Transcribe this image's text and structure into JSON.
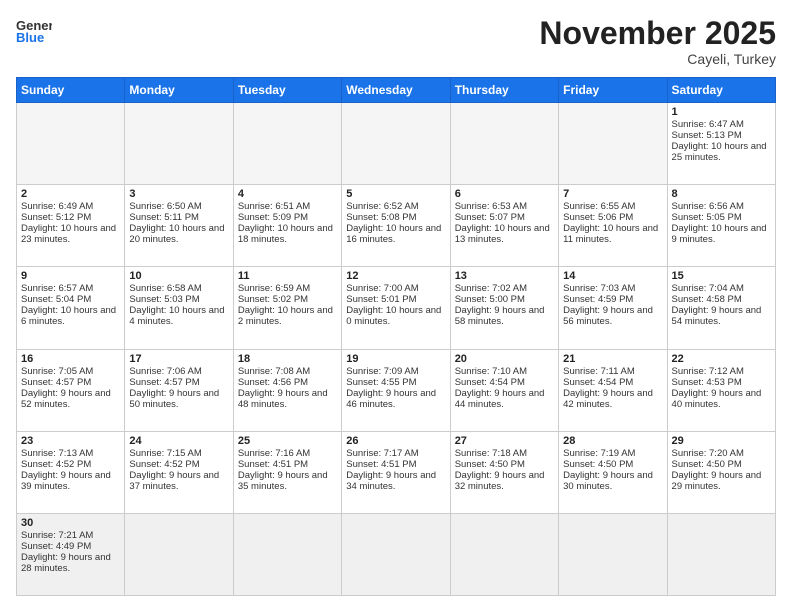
{
  "header": {
    "logo_general": "General",
    "logo_blue": "Blue",
    "month_title": "November 2025",
    "location": "Cayeli, Turkey"
  },
  "days_of_week": [
    "Sunday",
    "Monday",
    "Tuesday",
    "Wednesday",
    "Thursday",
    "Friday",
    "Saturday"
  ],
  "weeks": [
    [
      {
        "day": "",
        "sunrise": "",
        "sunset": "",
        "daylight": "",
        "empty": true
      },
      {
        "day": "",
        "sunrise": "",
        "sunset": "",
        "daylight": "",
        "empty": true
      },
      {
        "day": "",
        "sunrise": "",
        "sunset": "",
        "daylight": "",
        "empty": true
      },
      {
        "day": "",
        "sunrise": "",
        "sunset": "",
        "daylight": "",
        "empty": true
      },
      {
        "day": "",
        "sunrise": "",
        "sunset": "",
        "daylight": "",
        "empty": true
      },
      {
        "day": "",
        "sunrise": "",
        "sunset": "",
        "daylight": "",
        "empty": true
      },
      {
        "day": "1",
        "sunrise": "Sunrise: 6:47 AM",
        "sunset": "Sunset: 5:13 PM",
        "daylight": "Daylight: 10 hours and 25 minutes.",
        "empty": false
      }
    ],
    [
      {
        "day": "2",
        "sunrise": "Sunrise: 6:49 AM",
        "sunset": "Sunset: 5:12 PM",
        "daylight": "Daylight: 10 hours and 23 minutes.",
        "empty": false
      },
      {
        "day": "3",
        "sunrise": "Sunrise: 6:50 AM",
        "sunset": "Sunset: 5:11 PM",
        "daylight": "Daylight: 10 hours and 20 minutes.",
        "empty": false
      },
      {
        "day": "4",
        "sunrise": "Sunrise: 6:51 AM",
        "sunset": "Sunset: 5:09 PM",
        "daylight": "Daylight: 10 hours and 18 minutes.",
        "empty": false
      },
      {
        "day": "5",
        "sunrise": "Sunrise: 6:52 AM",
        "sunset": "Sunset: 5:08 PM",
        "daylight": "Daylight: 10 hours and 16 minutes.",
        "empty": false
      },
      {
        "day": "6",
        "sunrise": "Sunrise: 6:53 AM",
        "sunset": "Sunset: 5:07 PM",
        "daylight": "Daylight: 10 hours and 13 minutes.",
        "empty": false
      },
      {
        "day": "7",
        "sunrise": "Sunrise: 6:55 AM",
        "sunset": "Sunset: 5:06 PM",
        "daylight": "Daylight: 10 hours and 11 minutes.",
        "empty": false
      },
      {
        "day": "8",
        "sunrise": "Sunrise: 6:56 AM",
        "sunset": "Sunset: 5:05 PM",
        "daylight": "Daylight: 10 hours and 9 minutes.",
        "empty": false
      }
    ],
    [
      {
        "day": "9",
        "sunrise": "Sunrise: 6:57 AM",
        "sunset": "Sunset: 5:04 PM",
        "daylight": "Daylight: 10 hours and 6 minutes.",
        "empty": false
      },
      {
        "day": "10",
        "sunrise": "Sunrise: 6:58 AM",
        "sunset": "Sunset: 5:03 PM",
        "daylight": "Daylight: 10 hours and 4 minutes.",
        "empty": false
      },
      {
        "day": "11",
        "sunrise": "Sunrise: 6:59 AM",
        "sunset": "Sunset: 5:02 PM",
        "daylight": "Daylight: 10 hours and 2 minutes.",
        "empty": false
      },
      {
        "day": "12",
        "sunrise": "Sunrise: 7:00 AM",
        "sunset": "Sunset: 5:01 PM",
        "daylight": "Daylight: 10 hours and 0 minutes.",
        "empty": false
      },
      {
        "day": "13",
        "sunrise": "Sunrise: 7:02 AM",
        "sunset": "Sunset: 5:00 PM",
        "daylight": "Daylight: 9 hours and 58 minutes.",
        "empty": false
      },
      {
        "day": "14",
        "sunrise": "Sunrise: 7:03 AM",
        "sunset": "Sunset: 4:59 PM",
        "daylight": "Daylight: 9 hours and 56 minutes.",
        "empty": false
      },
      {
        "day": "15",
        "sunrise": "Sunrise: 7:04 AM",
        "sunset": "Sunset: 4:58 PM",
        "daylight": "Daylight: 9 hours and 54 minutes.",
        "empty": false
      }
    ],
    [
      {
        "day": "16",
        "sunrise": "Sunrise: 7:05 AM",
        "sunset": "Sunset: 4:57 PM",
        "daylight": "Daylight: 9 hours and 52 minutes.",
        "empty": false
      },
      {
        "day": "17",
        "sunrise": "Sunrise: 7:06 AM",
        "sunset": "Sunset: 4:57 PM",
        "daylight": "Daylight: 9 hours and 50 minutes.",
        "empty": false
      },
      {
        "day": "18",
        "sunrise": "Sunrise: 7:08 AM",
        "sunset": "Sunset: 4:56 PM",
        "daylight": "Daylight: 9 hours and 48 minutes.",
        "empty": false
      },
      {
        "day": "19",
        "sunrise": "Sunrise: 7:09 AM",
        "sunset": "Sunset: 4:55 PM",
        "daylight": "Daylight: 9 hours and 46 minutes.",
        "empty": false
      },
      {
        "day": "20",
        "sunrise": "Sunrise: 7:10 AM",
        "sunset": "Sunset: 4:54 PM",
        "daylight": "Daylight: 9 hours and 44 minutes.",
        "empty": false
      },
      {
        "day": "21",
        "sunrise": "Sunrise: 7:11 AM",
        "sunset": "Sunset: 4:54 PM",
        "daylight": "Daylight: 9 hours and 42 minutes.",
        "empty": false
      },
      {
        "day": "22",
        "sunrise": "Sunrise: 7:12 AM",
        "sunset": "Sunset: 4:53 PM",
        "daylight": "Daylight: 9 hours and 40 minutes.",
        "empty": false
      }
    ],
    [
      {
        "day": "23",
        "sunrise": "Sunrise: 7:13 AM",
        "sunset": "Sunset: 4:52 PM",
        "daylight": "Daylight: 9 hours and 39 minutes.",
        "empty": false
      },
      {
        "day": "24",
        "sunrise": "Sunrise: 7:15 AM",
        "sunset": "Sunset: 4:52 PM",
        "daylight": "Daylight: 9 hours and 37 minutes.",
        "empty": false
      },
      {
        "day": "25",
        "sunrise": "Sunrise: 7:16 AM",
        "sunset": "Sunset: 4:51 PM",
        "daylight": "Daylight: 9 hours and 35 minutes.",
        "empty": false
      },
      {
        "day": "26",
        "sunrise": "Sunrise: 7:17 AM",
        "sunset": "Sunset: 4:51 PM",
        "daylight": "Daylight: 9 hours and 34 minutes.",
        "empty": false
      },
      {
        "day": "27",
        "sunrise": "Sunrise: 7:18 AM",
        "sunset": "Sunset: 4:50 PM",
        "daylight": "Daylight: 9 hours and 32 minutes.",
        "empty": false
      },
      {
        "day": "28",
        "sunrise": "Sunrise: 7:19 AM",
        "sunset": "Sunset: 4:50 PM",
        "daylight": "Daylight: 9 hours and 30 minutes.",
        "empty": false
      },
      {
        "day": "29",
        "sunrise": "Sunrise: 7:20 AM",
        "sunset": "Sunset: 4:50 PM",
        "daylight": "Daylight: 9 hours and 29 minutes.",
        "empty": false
      }
    ],
    [
      {
        "day": "30",
        "sunrise": "Sunrise: 7:21 AM",
        "sunset": "Sunset: 4:49 PM",
        "daylight": "Daylight: 9 hours and 28 minutes.",
        "empty": false
      },
      {
        "day": "",
        "sunrise": "",
        "sunset": "",
        "daylight": "",
        "empty": true
      },
      {
        "day": "",
        "sunrise": "",
        "sunset": "",
        "daylight": "",
        "empty": true
      },
      {
        "day": "",
        "sunrise": "",
        "sunset": "",
        "daylight": "",
        "empty": true
      },
      {
        "day": "",
        "sunrise": "",
        "sunset": "",
        "daylight": "",
        "empty": true
      },
      {
        "day": "",
        "sunrise": "",
        "sunset": "",
        "daylight": "",
        "empty": true
      },
      {
        "day": "",
        "sunrise": "",
        "sunset": "",
        "daylight": "",
        "empty": true
      }
    ]
  ]
}
